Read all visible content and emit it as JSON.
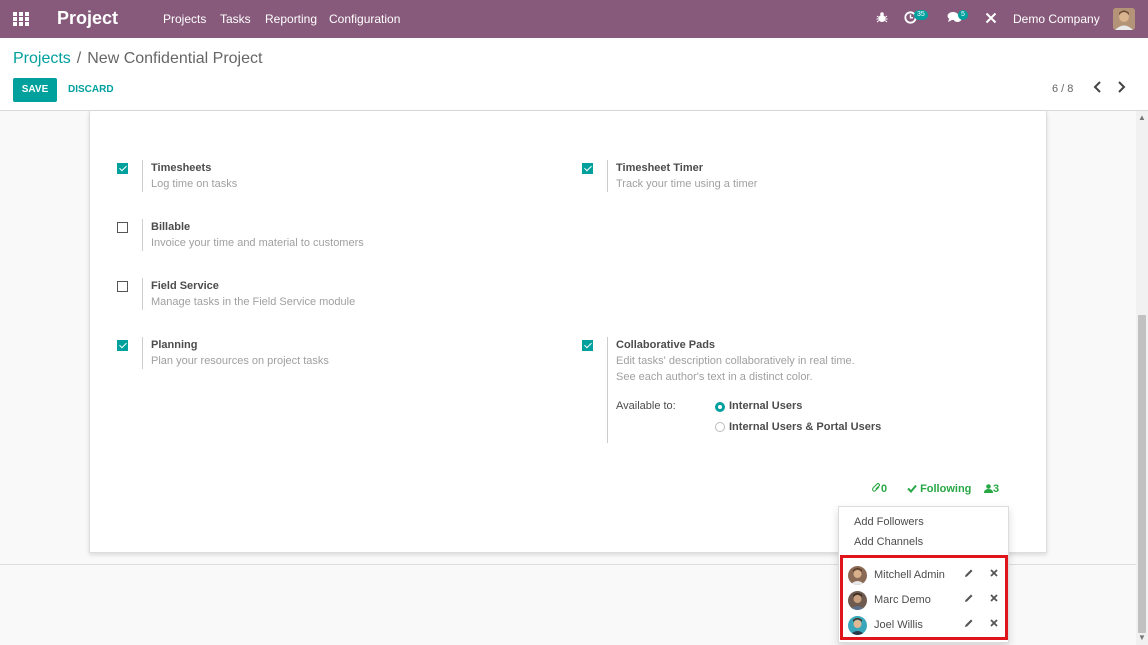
{
  "app": {
    "title": "Project"
  },
  "nav": {
    "menu": [
      "Projects",
      "Tasks",
      "Reporting",
      "Configuration"
    ],
    "activity_count": "35",
    "messages_count": "5",
    "company": "Demo Company"
  },
  "breadcrumb": {
    "parent": "Projects",
    "separator": "/",
    "current": "New Confidential Project"
  },
  "toolbar": {
    "save_label": "SAVE",
    "discard_label": "DISCARD"
  },
  "pager": {
    "value": "6 / 8"
  },
  "settings": [
    {
      "title": "Timesheets",
      "desc": "Log time on tasks",
      "checked": true
    },
    {
      "title": "Timesheet Timer",
      "desc": "Track your time using a timer",
      "checked": true
    },
    {
      "title": "Billable",
      "desc": "Invoice your time and material to customers",
      "checked": false
    },
    {
      "title": "Field Service",
      "desc": "Manage tasks in the Field Service module",
      "checked": false
    },
    {
      "title": "Planning",
      "desc": "Plan your resources on project tasks",
      "checked": true
    },
    {
      "title": "Collaborative Pads",
      "desc": "Edit tasks' description collaboratively in real time.",
      "desc2": "See each author's text in a distinct color.",
      "checked": true
    }
  ],
  "availability": {
    "label": "Available to:",
    "options": [
      {
        "label": "Internal Users",
        "selected": true
      },
      {
        "label": "Internal Users & Portal Users",
        "selected": false
      }
    ]
  },
  "chatter": {
    "attachments": "0",
    "following_label": "Following",
    "followers_count": "3"
  },
  "followers_menu": {
    "add_followers": "Add Followers",
    "add_channels": "Add Channels",
    "followers": [
      {
        "name": "Mitchell Admin",
        "icon": "avatar-mitchell"
      },
      {
        "name": "Marc Demo",
        "icon": "avatar-marc"
      },
      {
        "name": "Joel Willis",
        "icon": "avatar-joel"
      }
    ]
  },
  "colors": {
    "brand": "#875a7b",
    "accent": "#00a09d",
    "follow": "#28a745",
    "highlight": "#e0141b"
  }
}
